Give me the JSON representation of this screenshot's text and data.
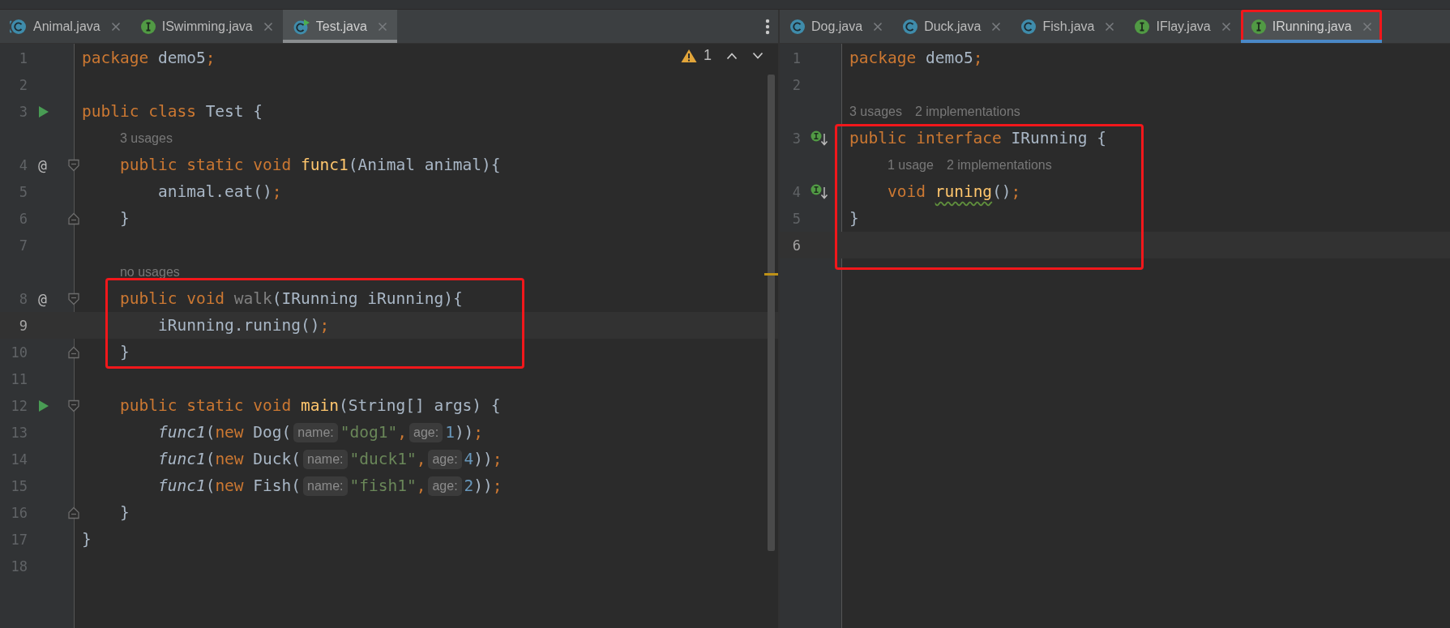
{
  "panes": [
    {
      "focused": false,
      "menu": true,
      "inspection": {
        "count": "1"
      },
      "tabs": [
        {
          "label": "Animal.java",
          "kind": "abstract",
          "selected": false,
          "boxed": false
        },
        {
          "label": "ISwimming.java",
          "kind": "interface",
          "selected": false,
          "boxed": false
        },
        {
          "label": "Test.java",
          "kind": "runnable",
          "selected": true,
          "boxed": false
        }
      ],
      "rows": [
        {
          "kind": "code",
          "number": "1",
          "tokens": [
            {
              "kind": "kw",
              "text": "package "
            },
            {
              "kind": "plain",
              "text": "demo5"
            },
            {
              "kind": "kw",
              "text": ";"
            }
          ]
        },
        {
          "kind": "code",
          "number": "2",
          "tokens": []
        },
        {
          "kind": "code",
          "number": "3",
          "gutter": {
            "kind": "run"
          },
          "tokens": [
            {
              "kind": "kw",
              "text": "public class "
            },
            {
              "kind": "plain",
              "text": "Test {"
            }
          ]
        },
        {
          "kind": "lens",
          "texts": [
            "3 usages"
          ]
        },
        {
          "kind": "code",
          "number": "4",
          "gutter": {
            "kind": "marker",
            "text": "@"
          },
          "fold_start": true,
          "tokens": [
            {
              "kind": "kw",
              "text": "    public static void "
            },
            {
              "kind": "fn",
              "text": "func1"
            },
            {
              "kind": "plain",
              "text": "(Animal animal){"
            }
          ]
        },
        {
          "kind": "code",
          "number": "5",
          "tokens": [
            {
              "kind": "plain",
              "text": "        animal.eat()"
            },
            {
              "kind": "kw",
              "text": ";"
            }
          ]
        },
        {
          "kind": "code",
          "number": "6",
          "fold_end": true,
          "tokens": [
            {
              "kind": "plain",
              "text": "    }"
            }
          ]
        },
        {
          "kind": "code",
          "number": "7",
          "tokens": []
        },
        {
          "kind": "lens",
          "texts": [
            "no usages"
          ]
        },
        {
          "kind": "code",
          "number": "8",
          "boxed": true,
          "gutter": {
            "kind": "marker",
            "text": "@"
          },
          "fold_start": true,
          "tokens": [
            {
              "kind": "kw",
              "text": "    public void "
            },
            {
              "kind": "unused",
              "text": "walk"
            },
            {
              "kind": "plain",
              "text": "(IRunning iRunning){"
            }
          ]
        },
        {
          "kind": "code",
          "number": "9",
          "boxed": true,
          "current": true,
          "tokens": [
            {
              "kind": "plain",
              "text": "        iRunning.runing()"
            },
            {
              "kind": "kw",
              "text": ";"
            }
          ]
        },
        {
          "kind": "code",
          "number": "10",
          "boxed": true,
          "fold_end": true,
          "tokens": [
            {
              "kind": "plain",
              "text": "    }"
            }
          ]
        },
        {
          "kind": "code",
          "number": "11",
          "tokens": []
        },
        {
          "kind": "code",
          "number": "12",
          "gutter": {
            "kind": "run"
          },
          "fold_start": true,
          "tokens": [
            {
              "kind": "kw",
              "text": "    public static void "
            },
            {
              "kind": "fn",
              "text": "main"
            },
            {
              "kind": "plain",
              "text": "(String[] args) {"
            }
          ]
        },
        {
          "kind": "code",
          "number": "13",
          "tokens": [
            {
              "kind": "call",
              "text": "        func1"
            },
            {
              "kind": "plain",
              "text": "("
            },
            {
              "kind": "kw",
              "text": "new "
            },
            {
              "kind": "plain",
              "text": "Dog("
            },
            {
              "kind": "hint",
              "text": "name:"
            },
            {
              "kind": "str",
              "text": "\"dog1\""
            },
            {
              "kind": "kw",
              "text": ","
            },
            {
              "kind": "hint",
              "text": "age:"
            },
            {
              "kind": "num",
              "text": "1"
            },
            {
              "kind": "plain",
              "text": "))"
            },
            {
              "kind": "kw",
              "text": ";"
            }
          ]
        },
        {
          "kind": "code",
          "number": "14",
          "tokens": [
            {
              "kind": "call",
              "text": "        func1"
            },
            {
              "kind": "plain",
              "text": "("
            },
            {
              "kind": "kw",
              "text": "new "
            },
            {
              "kind": "plain",
              "text": "Duck("
            },
            {
              "kind": "hint",
              "text": "name:"
            },
            {
              "kind": "str",
              "text": "\"duck1\""
            },
            {
              "kind": "kw",
              "text": ","
            },
            {
              "kind": "hint",
              "text": "age:"
            },
            {
              "kind": "num",
              "text": "4"
            },
            {
              "kind": "plain",
              "text": "))"
            },
            {
              "kind": "kw",
              "text": ";"
            }
          ]
        },
        {
          "kind": "code",
          "number": "15",
          "tokens": [
            {
              "kind": "call",
              "text": "        func1"
            },
            {
              "kind": "plain",
              "text": "("
            },
            {
              "kind": "kw",
              "text": "new "
            },
            {
              "kind": "plain",
              "text": "Fish("
            },
            {
              "kind": "hint",
              "text": "name:"
            },
            {
              "kind": "str",
              "text": "\"fish1\""
            },
            {
              "kind": "kw",
              "text": ","
            },
            {
              "kind": "hint",
              "text": "age:"
            },
            {
              "kind": "num",
              "text": "2"
            },
            {
              "kind": "plain",
              "text": "))"
            },
            {
              "kind": "kw",
              "text": ";"
            }
          ]
        },
        {
          "kind": "code",
          "number": "16",
          "fold_end": true,
          "tokens": [
            {
              "kind": "plain",
              "text": "    }"
            }
          ]
        },
        {
          "kind": "code",
          "number": "17",
          "tokens": [
            {
              "kind": "plain",
              "text": "}"
            }
          ]
        },
        {
          "kind": "code",
          "number": "18",
          "tokens": []
        }
      ]
    },
    {
      "focused": true,
      "tabs": [
        {
          "label": "Dog.java",
          "kind": "class",
          "selected": false,
          "boxed": false
        },
        {
          "label": "Duck.java",
          "kind": "class",
          "selected": false,
          "boxed": false
        },
        {
          "label": "Fish.java",
          "kind": "class",
          "selected": false,
          "boxed": false
        },
        {
          "label": "IFlay.java",
          "kind": "interface",
          "selected": false,
          "boxed": false
        },
        {
          "label": "IRunning.java",
          "kind": "interface",
          "selected": true,
          "boxed": true
        }
      ],
      "rows": [
        {
          "kind": "code",
          "number": "1",
          "tokens": [
            {
              "kind": "kw",
              "text": "package "
            },
            {
              "kind": "plain",
              "text": "demo5"
            },
            {
              "kind": "kw",
              "text": ";"
            }
          ]
        },
        {
          "kind": "code",
          "number": "2",
          "tokens": []
        },
        {
          "kind": "lens",
          "texts": [
            "3 usages",
            "2 implementations"
          ]
        },
        {
          "kind": "code",
          "number": "3",
          "boxed": true,
          "gutter": {
            "kind": "implemented"
          },
          "tokens": [
            {
              "kind": "kw",
              "text": "public interface "
            },
            {
              "kind": "plain",
              "text": "IRunning {"
            }
          ]
        },
        {
          "kind": "lens",
          "boxed": true,
          "texts": [
            "1 usage",
            "2 implementations"
          ]
        },
        {
          "kind": "code",
          "number": "4",
          "boxed": true,
          "gutter": {
            "kind": "implemented"
          },
          "tokens": [
            {
              "kind": "kw",
              "text": "    void "
            },
            {
              "kind": "fn_warn",
              "text": "runing"
            },
            {
              "kind": "plain",
              "text": "()"
            },
            {
              "kind": "kw",
              "text": ";"
            }
          ]
        },
        {
          "kind": "code",
          "number": "5",
          "boxed": true,
          "tokens": [
            {
              "kind": "plain",
              "text": "}"
            }
          ]
        },
        {
          "kind": "code",
          "number": "6",
          "boxed": true,
          "current": true,
          "tokens": []
        }
      ]
    }
  ]
}
